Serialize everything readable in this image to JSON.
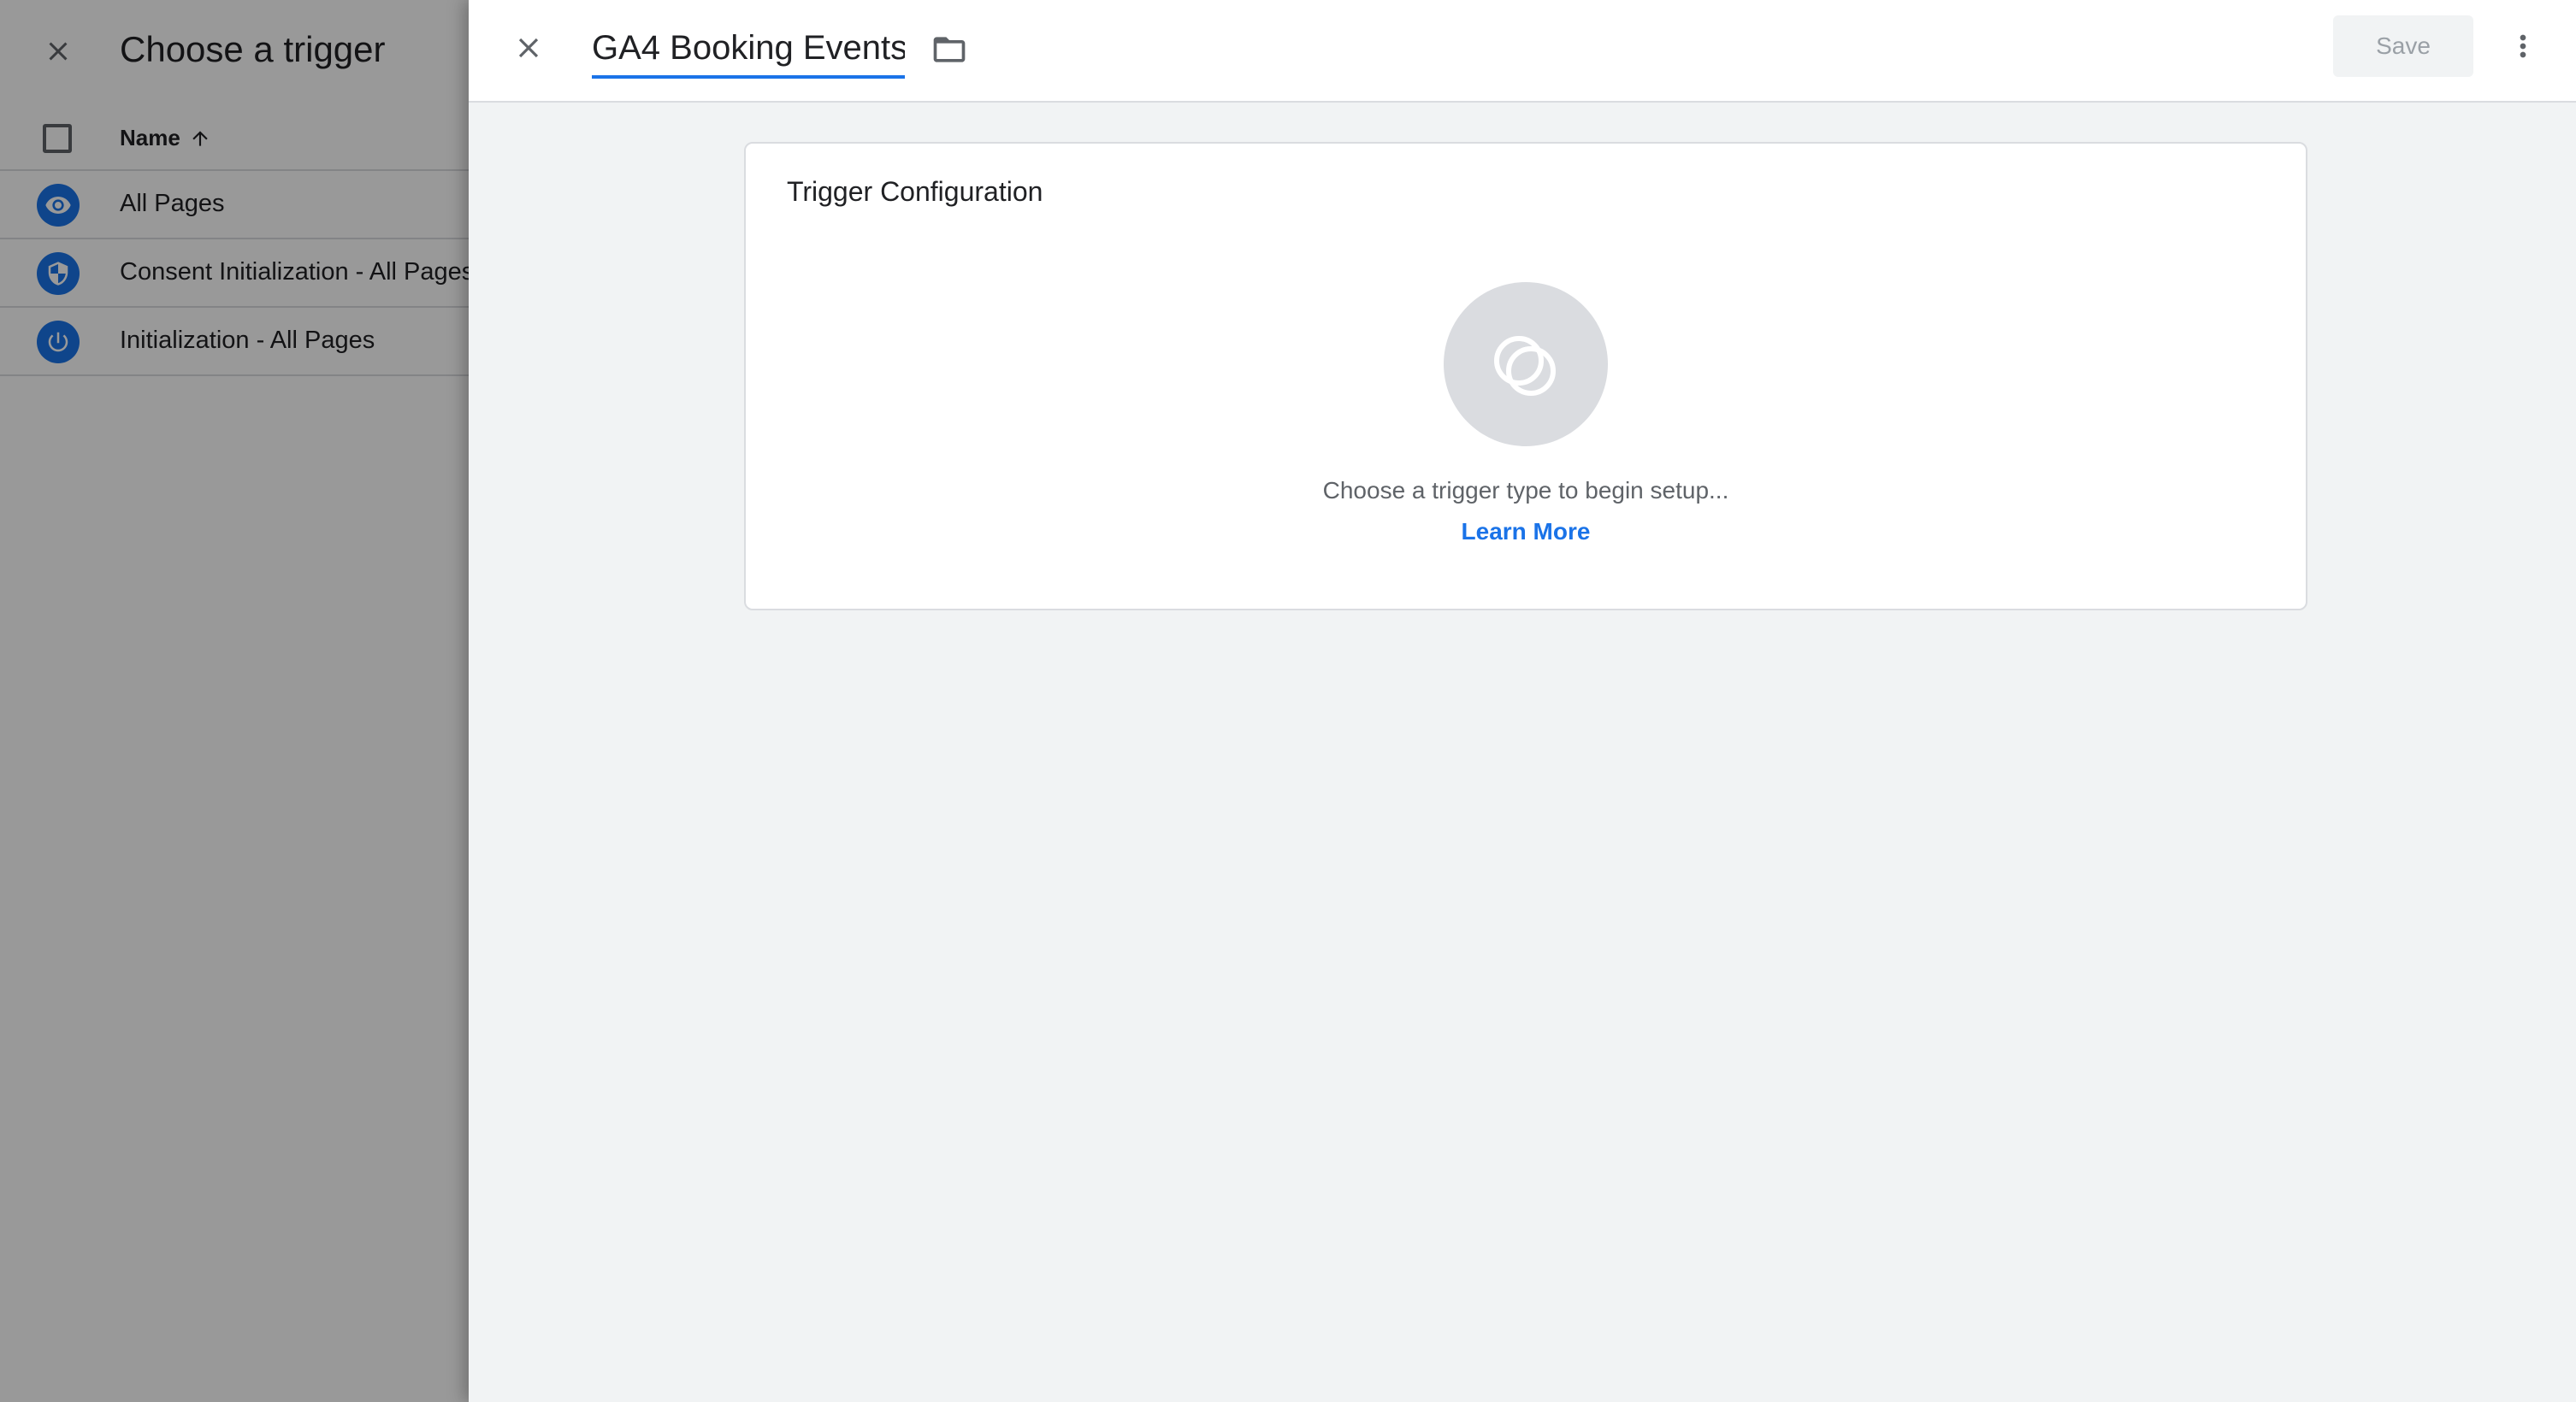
{
  "left_panel": {
    "title": "Choose a trigger",
    "column_header": "Name",
    "sort_direction": "ascending",
    "triggers": [
      {
        "label": "All Pages",
        "icon": "eye-icon"
      },
      {
        "label": "Consent Initialization - All Pages",
        "icon": "shield-icon"
      },
      {
        "label": "Initialization - All Pages",
        "icon": "power-icon"
      }
    ]
  },
  "sheet": {
    "trigger_name": "GA4 Booking Events",
    "save_label": "Save",
    "card": {
      "title": "Trigger Configuration",
      "hint": "Choose a trigger type to begin setup...",
      "learn_more": "Learn More"
    }
  },
  "colors": {
    "accent": "#1a73e8",
    "sheet_background": "#f1f3f4",
    "scrim": "rgba(0,0,0,0.40)",
    "disabled_text": "#9aa0a6"
  }
}
